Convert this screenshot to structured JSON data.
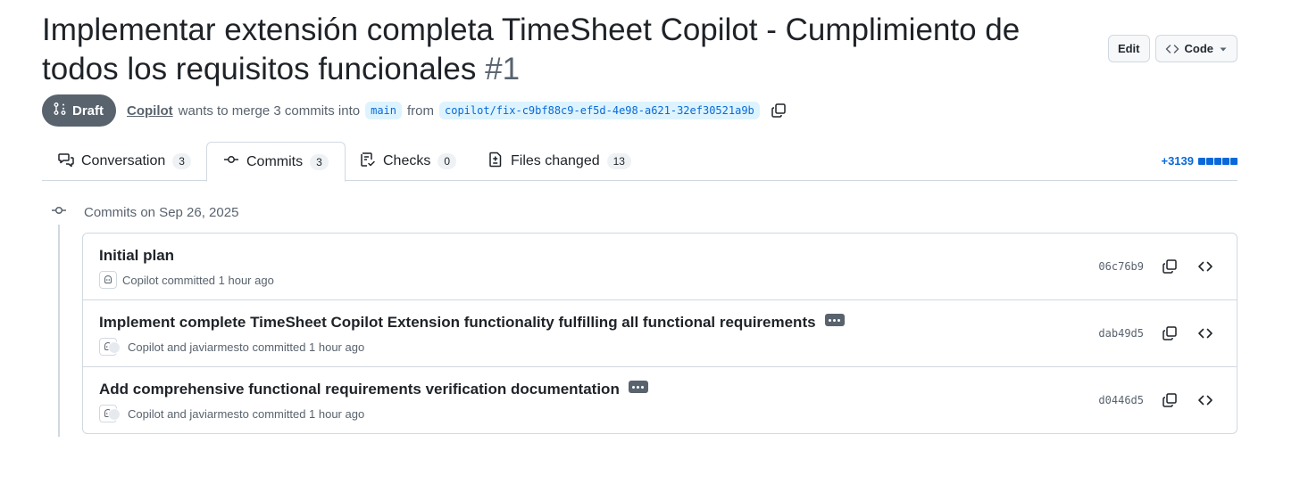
{
  "title": {
    "text": "Implementar extensión completa TimeSheet Copilot - Cumplimiento de todos los requisitos funcionales",
    "number": "#1"
  },
  "top_actions": {
    "edit_label": "Edit",
    "code_label": "Code"
  },
  "meta": {
    "status": "Draft",
    "author": "Copilot",
    "text_before_base": "wants to merge 3 commits into",
    "base_branch": "main",
    "text_from": "from",
    "head_branch": "copilot/fix-c9bf88c9-ef5d-4e98-a621-32ef30521a9b"
  },
  "tabs": [
    {
      "label": "Conversation",
      "count": "3",
      "icon": "comment-discussion-icon"
    },
    {
      "label": "Commits",
      "count": "3",
      "icon": "git-commit-icon"
    },
    {
      "label": "Checks",
      "count": "0",
      "icon": "checklist-icon"
    },
    {
      "label": "Files changed",
      "count": "13",
      "icon": "file-diff-icon"
    }
  ],
  "diffstat": {
    "additions": "+3139"
  },
  "timeline": {
    "heading": "Commits on Sep 26, 2025"
  },
  "commits": [
    {
      "message": "Initial plan",
      "byline": "Copilot committed 1 hour ago",
      "sha": "06c76b9",
      "has_more": false
    },
    {
      "message": "Implement complete TimeSheet Copilot Extension functionality fulfilling all functional requirements",
      "byline": "Copilot and javiarmesto committed 1 hour ago",
      "sha": "dab49d5",
      "has_more": true
    },
    {
      "message": "Add comprehensive functional requirements verification documentation",
      "byline": "Copilot and javiarmesto committed 1 hour ago",
      "sha": "d0446d5",
      "has_more": true
    }
  ],
  "colors": {
    "accent": "#0969da",
    "draft_badge": "#59636e",
    "border": "#d1d9e0",
    "muted_text": "#59636e"
  }
}
